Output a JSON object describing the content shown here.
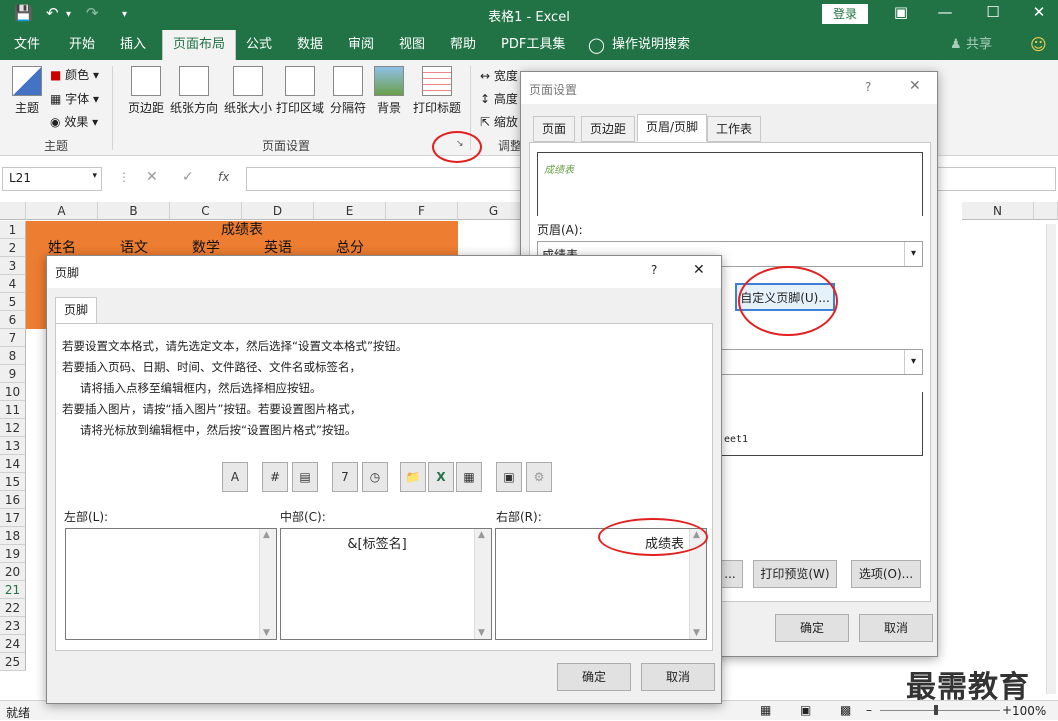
{
  "app": {
    "doc_title": "表格1 - Excel",
    "login": "登录"
  },
  "tabs": [
    "文件",
    "开始",
    "插入",
    "页面布局",
    "公式",
    "数据",
    "审阅",
    "视图",
    "帮助",
    "PDF工具集",
    "操作说明搜索",
    "共享"
  ],
  "ribbon": {
    "theme": {
      "main": "主题",
      "colors": "颜色",
      "fonts": "字体",
      "effects": "效果",
      "group": "主题"
    },
    "page_setup": {
      "margins": "页边距",
      "orientation": "纸张方向",
      "size": "纸张大小",
      "print_area": "打印区域",
      "breaks": "分隔符",
      "background": "背景",
      "print_titles": "打印标题",
      "group": "页面设置"
    },
    "scale": {
      "width": "宽度",
      "height": "高度",
      "scale": "缩放",
      "group": "调整"
    }
  },
  "formula_bar": {
    "name_box": "L21",
    "fx": "fx"
  },
  "columns": [
    "A",
    "B",
    "C",
    "D",
    "E",
    "F",
    "G",
    "N"
  ],
  "rows": [
    "1",
    "2",
    "3",
    "4",
    "5",
    "6",
    "7",
    "8",
    "9",
    "10",
    "11",
    "12",
    "13",
    "14",
    "15",
    "16",
    "17",
    "18",
    "19",
    "20",
    "21",
    "22",
    "23",
    "24",
    "25"
  ],
  "sheet": {
    "title": "成绩表",
    "headers": [
      "姓名",
      "语文",
      "数学",
      "英语",
      "总分"
    ]
  },
  "status": {
    "ready": "就绪",
    "zoom": "100%"
  },
  "page_setup_dialog": {
    "title": "页面设置",
    "tabs": [
      "页面",
      "页边距",
      "页眉/页脚",
      "工作表"
    ],
    "preview_text": "成绩表",
    "header_label": "页眉(A):",
    "header_value": "成绩表",
    "custom_footer": "自定义页脚(U)...",
    "footer_preview": "eet1",
    "print_btn": "...",
    "print_preview": "打印预览(W)",
    "options": "选项(O)...",
    "ok": "确定",
    "cancel": "取消"
  },
  "footer_dialog": {
    "title": "页脚",
    "help": "?",
    "tab": "页脚",
    "instructions": [
      "若要设置文本格式，请先选定文本，然后选择“设置文本格式”按钮。",
      "若要插入页码、日期、时间、文件路径、文件名或标签名，",
      "请将插入点移至编辑框内，然后选择相应按钮。",
      "若要插入图片，请按“插入图片”按钮。若要设置图片格式，",
      "请将光标放到编辑框中，然后按“设置图片格式”按钮。"
    ],
    "left_label": "左部(L):",
    "center_label": "中部(C):",
    "right_label": "右部(R):",
    "left_text": "",
    "center_text": "&[标签名]",
    "right_text": "成绩表",
    "ok": "确定",
    "cancel": "取消"
  },
  "watermark": "最需教育",
  "colors": {
    "excel_green": "#217346",
    "orange": "#ed7d31",
    "annotation_red": "#e32020"
  }
}
